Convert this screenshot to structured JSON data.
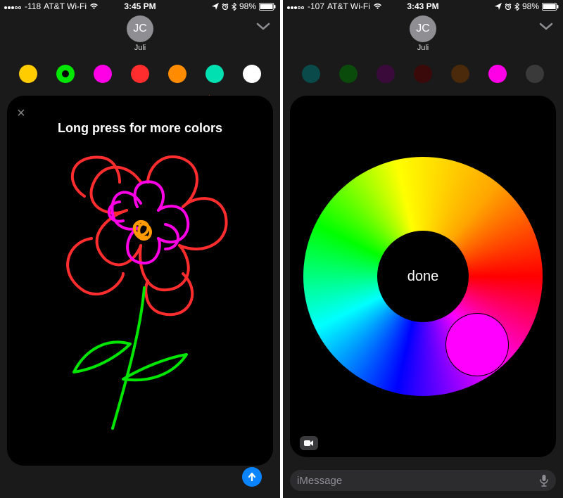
{
  "left": {
    "status": {
      "signal": "-118",
      "carrier": "AT&T Wi-Fi",
      "time": "3:45 PM",
      "battery": "98%"
    },
    "contact": {
      "initials": "JC",
      "name": "Juli"
    },
    "palette": [
      {
        "name": "yellow",
        "color": "#ffcc00",
        "selected": false
      },
      {
        "name": "green",
        "color": "#00e600",
        "selected": true
      },
      {
        "name": "magenta",
        "color": "#ff00e6",
        "selected": false
      },
      {
        "name": "red",
        "color": "#ff2d2d",
        "selected": false
      },
      {
        "name": "orange",
        "color": "#ff8c00",
        "selected": false
      },
      {
        "name": "teal",
        "color": "#00e0b0",
        "selected": false
      },
      {
        "name": "white",
        "color": "#ffffff",
        "selected": false
      }
    ],
    "annotation": "Long press for more colors",
    "close_label": "×"
  },
  "right": {
    "status": {
      "signal": "-107",
      "carrier": "AT&T Wi-Fi",
      "time": "3:43 PM",
      "battery": "98%"
    },
    "contact": {
      "initials": "JC",
      "name": "Juli"
    },
    "palette": [
      {
        "name": "teal-dim",
        "color": "#0a4a4a"
      },
      {
        "name": "green-dim",
        "color": "#0a4a0a"
      },
      {
        "name": "magenta-dim",
        "color": "#3a0a3a"
      },
      {
        "name": "red-dim",
        "color": "#3a0a0a"
      },
      {
        "name": "orange-dim",
        "color": "#4a2a0a"
      },
      {
        "name": "magenta",
        "color": "#ff00e6"
      },
      {
        "name": "gray-dim",
        "color": "#3a3a3a"
      }
    ],
    "done_label": "done",
    "input_placeholder": "iMessage"
  }
}
